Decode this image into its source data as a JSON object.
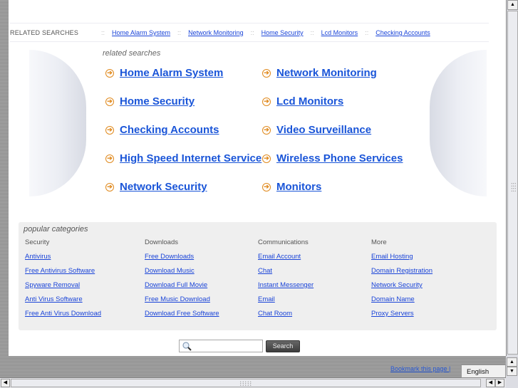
{
  "related_bar": {
    "label": "RELATED SEARCHES",
    "separator": "::",
    "links": [
      "Home Alarm System",
      "Network Monitoring",
      "Home Security",
      "Lcd Monitors",
      "Checking Accounts"
    ]
  },
  "related_searches": {
    "title": "related searches",
    "arrow_icon": "➔",
    "items": [
      "Home Alarm System",
      "Network Monitoring",
      "Home Security",
      "Lcd Monitors",
      "Checking Accounts",
      "Video Surveillance",
      "High Speed Internet Service",
      "Wireless Phone Services",
      "Network Security",
      "Monitors"
    ]
  },
  "popular": {
    "title": "popular categories",
    "columns": [
      {
        "heading": "Security",
        "links": [
          "Antivirus",
          "Free Antivirus Software",
          "Spyware Removal",
          "Anti Virus Software",
          "Free Anti Virus Download"
        ]
      },
      {
        "heading": "Downloads",
        "links": [
          "Free Downloads",
          "Download Music",
          "Download Full Movie",
          "Free Music Download",
          "Download Free Software"
        ]
      },
      {
        "heading": "Communications",
        "links": [
          "Email Account",
          "Chat",
          "Instant Messenger",
          "Email",
          "Chat Room"
        ]
      },
      {
        "heading": "More",
        "links": [
          "Email Hosting",
          "Domain Registration",
          "Network Security",
          "Domain Name",
          "Proxy Servers"
        ]
      }
    ]
  },
  "search": {
    "placeholder": "",
    "button_label": "Search"
  },
  "footer": {
    "bookmark_label": "Bookmark this page |",
    "language": "English"
  },
  "scroll_glyphs": {
    "up": "▲",
    "down": "▼",
    "left": "◀",
    "right": "▶"
  }
}
